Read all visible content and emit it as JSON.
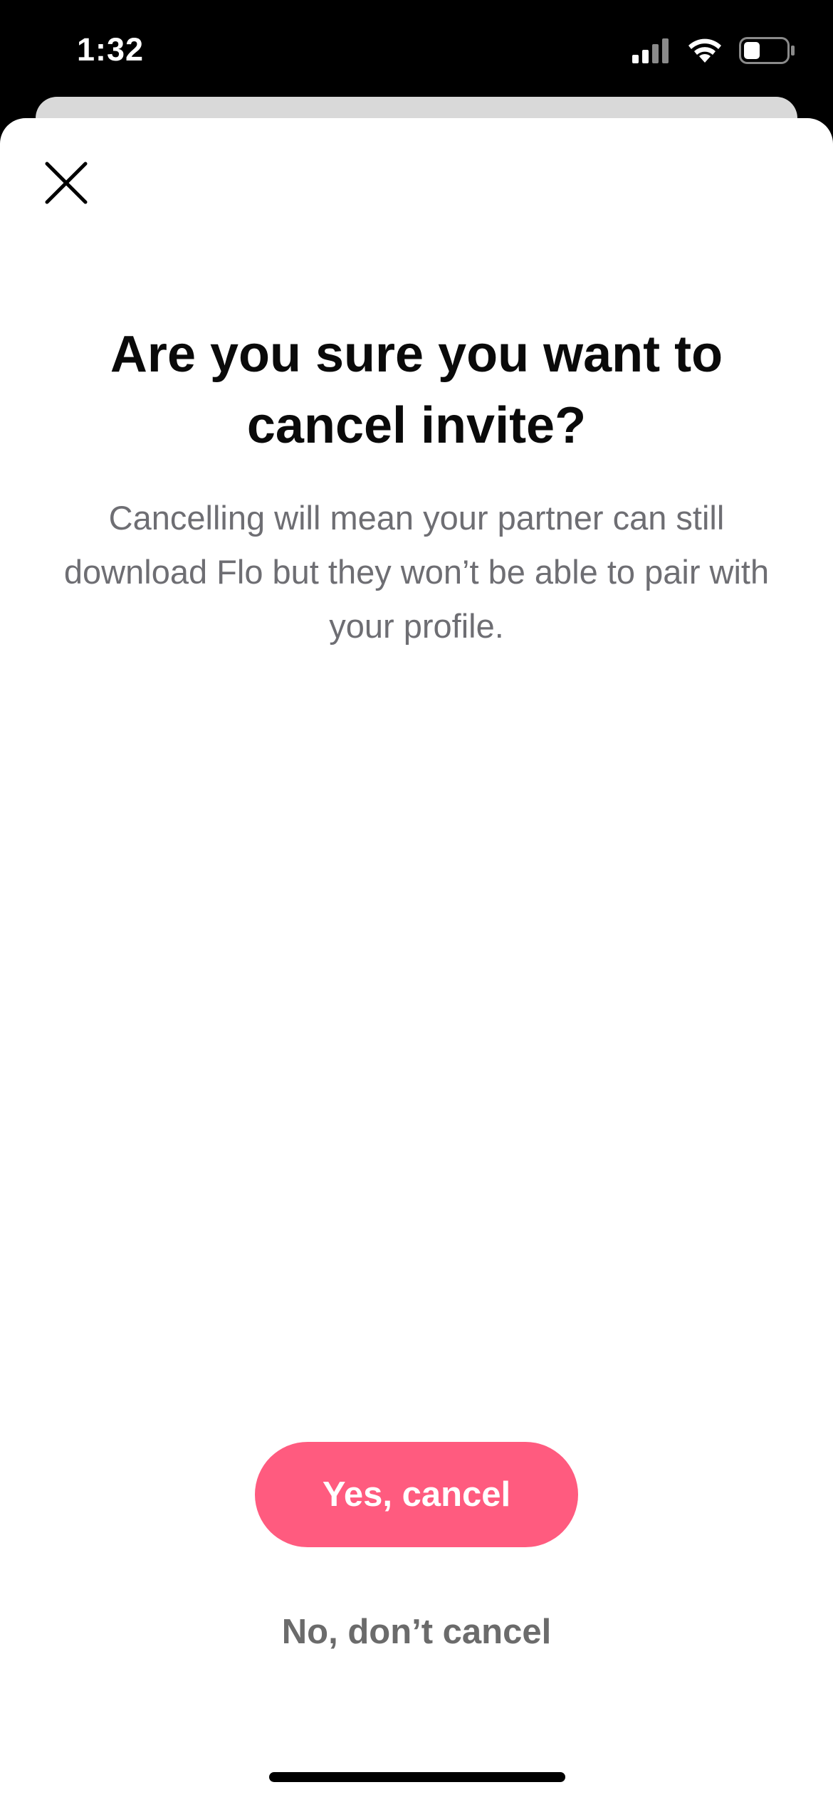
{
  "status_bar": {
    "time": "1:32",
    "icons": [
      "signal-icon",
      "wifi-icon",
      "battery-icon"
    ]
  },
  "modal": {
    "close_icon": "close-icon",
    "title": "Are you sure you want to cancel invite?",
    "subtitle": "Cancelling will mean your partner can still download Flo but they won’t be able to pair with your profile.",
    "primary_button_label": "Yes, cancel",
    "secondary_button_label": "No, don’t cancel"
  },
  "colors": {
    "accent": "#ff5b7f",
    "title_text": "#0a0a0a",
    "body_text": "#6e6e73",
    "secondary_text": "#6b6b6b"
  }
}
